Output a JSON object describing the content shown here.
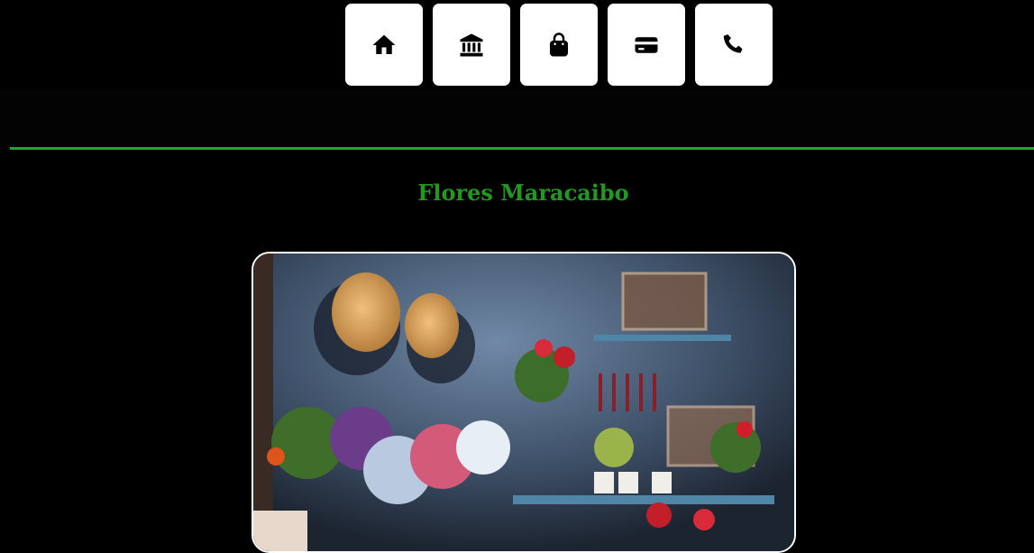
{
  "nav": {
    "items": [
      {
        "icon": "home-icon",
        "label": "Inicio"
      },
      {
        "icon": "bank-icon",
        "label": "Banco"
      },
      {
        "icon": "shopping-bag-icon",
        "label": "Tienda"
      },
      {
        "icon": "credit-card-icon",
        "label": "Pago"
      },
      {
        "icon": "phone-icon",
        "label": "Contacto"
      }
    ]
  },
  "page": {
    "title": "Flores Maracaibo"
  },
  "image": {
    "description_icon": "flower-shop-photo",
    "alt": "Flores Maracaibo"
  },
  "colors": {
    "background": "#000000",
    "accent": "#1f9a1f",
    "divider": "#1faa1f",
    "button_bg": "#ffffff"
  }
}
